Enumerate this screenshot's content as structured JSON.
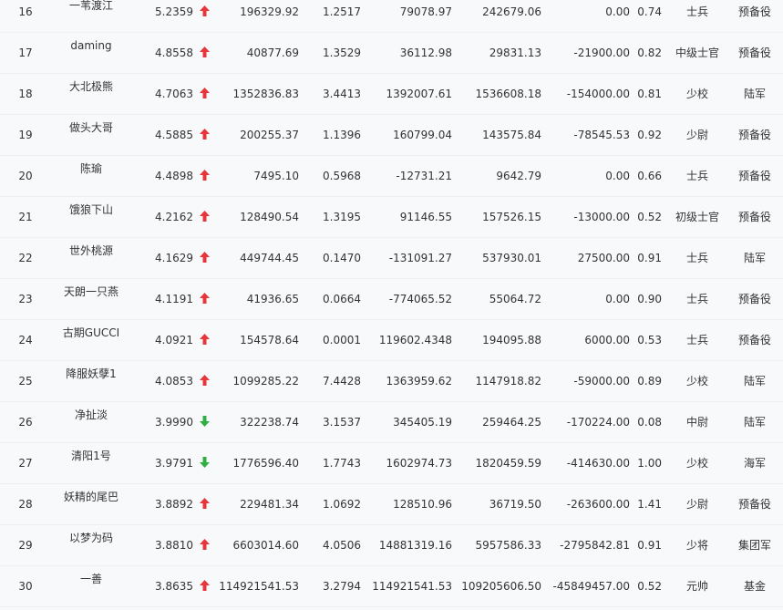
{
  "colors": {
    "up": "#e8353a",
    "down": "#2fae41",
    "text": "#333333",
    "row_border": "#eceef2",
    "background": "#f8f9fb"
  },
  "rows": [
    {
      "rank": "16",
      "name": "一苇渡江",
      "score": "5.2359",
      "trend": "up",
      "v1": "196329.92",
      "v2": "1.2517",
      "v3": "79078.97",
      "v4": "242679.06",
      "v5": "0.00",
      "v6": "0.74",
      "title": "士兵",
      "unit": "预备役"
    },
    {
      "rank": "17",
      "name": "daming",
      "score": "4.8558",
      "trend": "up",
      "v1": "40877.69",
      "v2": "1.3529",
      "v3": "36112.98",
      "v4": "29831.13",
      "v5": "-21900.00",
      "v6": "0.82",
      "title": "中级士官",
      "unit": "预备役"
    },
    {
      "rank": "18",
      "name": "大北极熊",
      "score": "4.7063",
      "trend": "up",
      "v1": "1352836.83",
      "v2": "3.4413",
      "v3": "1392007.61",
      "v4": "1536608.18",
      "v5": "-154000.00",
      "v6": "0.81",
      "title": "少校",
      "unit": "陆军"
    },
    {
      "rank": "19",
      "name": "做头大哥",
      "score": "4.5885",
      "trend": "up",
      "v1": "200255.37",
      "v2": "1.1396",
      "v3": "160799.04",
      "v4": "143575.84",
      "v5": "-78545.53",
      "v6": "0.92",
      "title": "少尉",
      "unit": "预备役"
    },
    {
      "rank": "20",
      "name": "陈瑜",
      "score": "4.4898",
      "trend": "up",
      "v1": "7495.10",
      "v2": "0.5968",
      "v3": "-12731.21",
      "v4": "9642.79",
      "v5": "0.00",
      "v6": "0.66",
      "title": "士兵",
      "unit": "预备役"
    },
    {
      "rank": "21",
      "name": "饿狼下山",
      "score": "4.2162",
      "trend": "up",
      "v1": "128490.54",
      "v2": "1.3195",
      "v3": "91146.55",
      "v4": "157526.15",
      "v5": "-13000.00",
      "v6": "0.52",
      "title": "初级士官",
      "unit": "预备役"
    },
    {
      "rank": "22",
      "name": "世外桃源",
      "score": "4.1629",
      "trend": "up",
      "v1": "449744.45",
      "v2": "0.1470",
      "v3": "-131091.27",
      "v4": "537930.01",
      "v5": "27500.00",
      "v6": "0.91",
      "title": "士兵",
      "unit": "陆军"
    },
    {
      "rank": "23",
      "name": "天朗一只燕",
      "score": "4.1191",
      "trend": "up",
      "v1": "41936.65",
      "v2": "0.0664",
      "v3": "-774065.52",
      "v4": "55064.72",
      "v5": "0.00",
      "v6": "0.90",
      "title": "士兵",
      "unit": "预备役"
    },
    {
      "rank": "24",
      "name": "古期GUCCI",
      "score": "4.0921",
      "trend": "up",
      "v1": "154578.64",
      "v2": "0.0001",
      "v3": "119602.4348",
      "v4": "194095.88",
      "v5": "6000.00",
      "v6": "0.53",
      "title": "士兵",
      "unit": "预备役"
    },
    {
      "rank": "25",
      "name": "降服妖孽1",
      "score": "4.0853",
      "trend": "up",
      "v1": "1099285.22",
      "v2": "7.4428",
      "v3": "1363959.62",
      "v4": "1147918.82",
      "v5": "-59000.00",
      "v6": "0.89",
      "title": "少校",
      "unit": "陆军"
    },
    {
      "rank": "26",
      "name": "净扯淡",
      "score": "3.9990",
      "trend": "down",
      "v1": "322238.74",
      "v2": "3.1537",
      "v3": "345405.19",
      "v4": "259464.25",
      "v5": "-170224.00",
      "v6": "0.08",
      "title": "中尉",
      "unit": "陆军"
    },
    {
      "rank": "27",
      "name": "清阳1号",
      "score": "3.9791",
      "trend": "down",
      "v1": "1776596.40",
      "v2": "1.7743",
      "v3": "1602974.73",
      "v4": "1820459.59",
      "v5": "-414630.00",
      "v6": "1.00",
      "title": "少校",
      "unit": "海军"
    },
    {
      "rank": "28",
      "name": "妖精的尾巴",
      "score": "3.8892",
      "trend": "up",
      "v1": "229481.34",
      "v2": "1.0692",
      "v3": "128510.96",
      "v4": "36719.50",
      "v5": "-263600.00",
      "v6": "1.41",
      "title": "少尉",
      "unit": "预备役"
    },
    {
      "rank": "29",
      "name": "以梦为码",
      "score": "3.8810",
      "trend": "up",
      "v1": "6603014.60",
      "v2": "4.0506",
      "v3": "14881319.16",
      "v4": "5957586.33",
      "v5": "-2795842.81",
      "v6": "0.91",
      "title": "少将",
      "unit": "集团军"
    },
    {
      "rank": "30",
      "name": "一善",
      "score": "3.8635",
      "trend": "up",
      "v1": "114921541.53",
      "v2": "3.2794",
      "v3": "114921541.53",
      "v4": "109205606.50",
      "v5": "-45849457.00",
      "v6": "0.52",
      "title": "元帅",
      "unit": "基金"
    }
  ]
}
